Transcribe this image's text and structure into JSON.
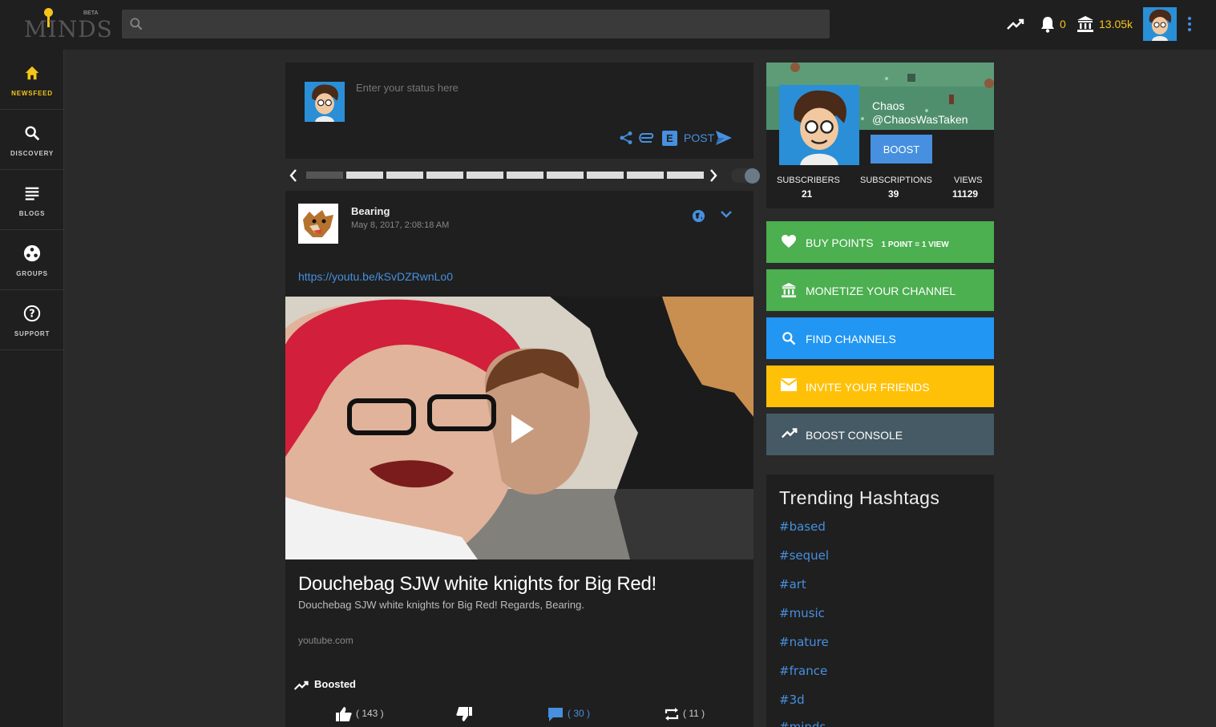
{
  "app": {
    "logo_text": "MINDS",
    "beta_label": "BETA"
  },
  "search": {
    "placeholder": "",
    "value": ""
  },
  "topbar": {
    "notifications_count": "0",
    "points_balance": "13.05k"
  },
  "sidebar": {
    "items": [
      {
        "label": "NEWSFEED",
        "icon": "home-icon"
      },
      {
        "label": "DISCOVERY",
        "icon": "search-icon"
      },
      {
        "label": "BLOGS",
        "icon": "blogs-icon"
      },
      {
        "label": "GROUPS",
        "icon": "groups-icon"
      },
      {
        "label": "SUPPORT",
        "icon": "help-icon"
      }
    ]
  },
  "composer": {
    "placeholder": "Enter your status here",
    "post_label": "POST",
    "blog_badge": "E"
  },
  "post": {
    "owner": "Bearing",
    "timestamp": "May 8, 2017, 2:08:18 AM",
    "link_text": "https://youtu.be/kSvDZRwnLo0",
    "title": "Douchebag SJW white knights for Big Red!",
    "description": "Douchebag SJW white knights for Big Red! Regards, Bearing.",
    "source": "youtube.com",
    "boosted_label": "Boosted",
    "actions": {
      "thumbs_up": "( 143 )",
      "comments": "( 30 )",
      "reminds": "( 11 )"
    }
  },
  "profile": {
    "name": "Chaos",
    "handle": "@ChaosWasTaken",
    "boost_label": "BOOST",
    "stats": [
      {
        "label": "SUBSCRIBERS",
        "value": "21"
      },
      {
        "label": "SUBSCRIPTIONS",
        "value": "39"
      },
      {
        "label": "VIEWS",
        "value": "11129"
      }
    ]
  },
  "ctas": {
    "buy_points": {
      "label": "BUY POINTS",
      "sub": "1 POINT = 1 VIEW",
      "color": "#4caf50"
    },
    "monetize": {
      "label": "MONETIZE YOUR CHANNEL",
      "color": "#4caf50"
    },
    "find_channels": {
      "label": "FIND CHANNELS",
      "color": "#2196f3"
    },
    "invite": {
      "label": "INVITE YOUR FRIENDS",
      "color": "#ffc107"
    },
    "boost_console": {
      "label": "BOOST CONSOLE",
      "color": "#455a64"
    }
  },
  "trending": {
    "title": "Trending Hashtags",
    "tags": [
      "#based",
      "#sequel",
      "#art",
      "#music",
      "#nature",
      "#france",
      "#3d",
      "#minds"
    ]
  },
  "colors": {
    "accent_yellow": "#f5c518",
    "link_blue": "#4690df",
    "panel": "#1f1f1f",
    "background": "#2a2a2a"
  }
}
